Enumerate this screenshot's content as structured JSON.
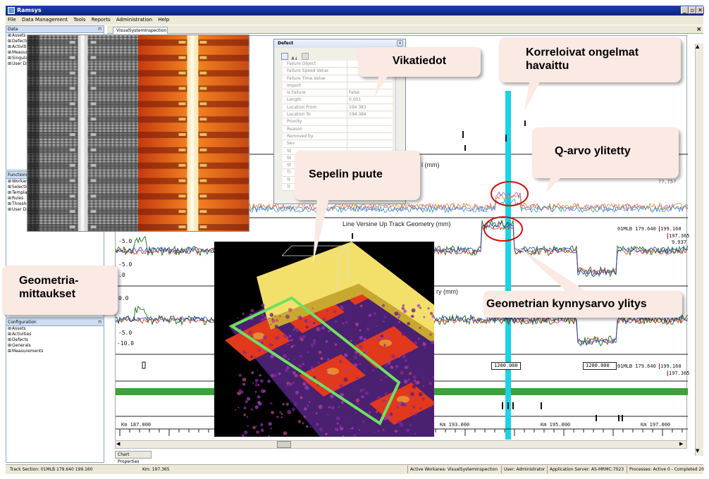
{
  "window": {
    "title": "Ramsys",
    "controls": [
      "_",
      "▫",
      "✕"
    ]
  },
  "menu": [
    "File",
    "Data Management",
    "Tools",
    "Reports",
    "Administration",
    "Help"
  ],
  "panels": {
    "data": {
      "title": "Data",
      "items": [
        "Assets",
        "Defects",
        "Activities",
        "Measurements",
        "Singularities",
        "User Data"
      ]
    },
    "functions": {
      "title": "Functions",
      "items": [
        "Workareas",
        "Selections",
        "Templates",
        "Rules",
        "Thresholds",
        "User Data"
      ]
    },
    "configuration": {
      "title": "Configuration",
      "items": [
        "Assets",
        "Activities",
        "Defects",
        "Generals",
        "Measurements"
      ]
    }
  },
  "main": {
    "tab": "VisualSystemInspection",
    "close": "×",
    "chart_tab": "Chart Properties"
  },
  "defect_dialog": {
    "title": "Defect",
    "rows": [
      {
        "name": "Failure Object",
        "value": ""
      },
      {
        "name": "Failure Speed Value",
        "value": ""
      },
      {
        "name": "Failure Time Value",
        "value": ""
      },
      {
        "name": "Import",
        "value": ""
      },
      {
        "name": "Is Failure",
        "value": "False"
      },
      {
        "name": "Length",
        "value": "0.001"
      },
      {
        "name": "Location From",
        "value": "194.383"
      },
      {
        "name": "Location To",
        "value": "194.384"
      },
      {
        "name": "Priority",
        "value": ""
      },
      {
        "name": "Reason",
        "value": ""
      },
      {
        "name": "Removed by",
        "value": ""
      },
      {
        "name": "Sev",
        "value": ""
      },
      {
        "name": "St",
        "value": ""
      },
      {
        "name": "St",
        "value": ""
      },
      {
        "name": "St",
        "value": ""
      },
      {
        "name": "Ti",
        "value": ""
      },
      {
        "name": "Tr",
        "value": ""
      },
      {
        "name": "Tr",
        "value": ""
      }
    ]
  },
  "charts": {
    "upper_label_fragment": "l (mm)",
    "line_versine": "Line Versine Up Track Geometry (mm)",
    "lower_label_fragment": "ry (mm)",
    "right_value_top": "??.?5?",
    "readout1": {
      "track": "01MLB",
      "km_start": "179.640",
      "km_end": "199.160",
      "v1": "197.365",
      "v2": "9.937"
    },
    "readout2": {
      "track": "01MLB",
      "km_start": "179.640",
      "km_end": "199.160",
      "v1": "197.365"
    },
    "left_ticks_upper": [
      "-5.0",
      "-5.0",
      ".0"
    ],
    "left_ticks_lower": [
      "0.0",
      "-5.0",
      "-10.0"
    ],
    "box_a": "1200.000",
    "box_b": "1200.000",
    "km_labels": [
      "Km 187.000",
      "Km 193.000",
      "Km 195.000",
      "Km 197.000"
    ]
  },
  "callouts": {
    "vikatiedot": "Vikatiedot",
    "korreloivat": "Korreloivat ongelmat havaittu",
    "qarvo": "Q-arvo ylitetty",
    "sepelin": "Sepelin puute",
    "geometria": "Geometria-mittaukset",
    "kynnys": "Geometrian kynnysarvo ylitys"
  },
  "statusbar": {
    "track_section": "Track Section: 01MLB 179.640 199.160",
    "km": "Km: 197.365",
    "workarea": "Active Workarea: VisualSystemInspection",
    "user": "User: Administrator",
    "server": "Application Server: AS-MRMC:7023",
    "processes": "Processes: Active 0 - Completed 20"
  },
  "colors": {
    "highlight": "#19d3e6",
    "green_band": "#3aa33a",
    "callout_bg": "#fbe9e4",
    "marker": "#d01010"
  }
}
